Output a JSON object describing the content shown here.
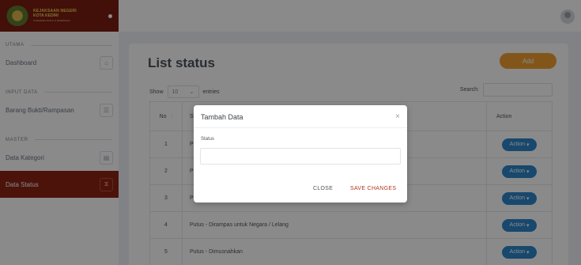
{
  "brand": {
    "line1": "KEJAKSAAN NEGERI",
    "line2": "KOTA KEDIRI",
    "line3": "SI-BARANG BUKTI & RAMPASAN"
  },
  "sidebar": {
    "section_utama": "UTAMA",
    "dashboard": "Dashboard",
    "section_input": "INPUT DATA",
    "barang": "Barang Bukti/Rampasan",
    "section_master": "MASTER",
    "kategori": "Data Kategori",
    "status": "Data Status",
    "icons": [
      "home-icon",
      "list-icon",
      "clipboard-icon",
      "hourglass-icon"
    ]
  },
  "page": {
    "title": "List status",
    "add_label": "Add",
    "show_label": "Show",
    "show_value": "10",
    "entries_label": "entries",
    "search_label": "Search:"
  },
  "table": {
    "col_no": "No",
    "col_status": "St",
    "col_action": "Action",
    "rows": [
      {
        "no": "1",
        "status": "P"
      },
      {
        "no": "2",
        "status": "P"
      },
      {
        "no": "3",
        "status": "P"
      },
      {
        "no": "4",
        "status": "Putus - Dirampas untuk Negara / Lelang"
      },
      {
        "no": "5",
        "status": "Putus - Dimusnahkan"
      }
    ],
    "action_label": "Action"
  },
  "modal": {
    "title": "Tambah Data",
    "close_glyph": "×",
    "field_label": "Status",
    "field_value": "",
    "close_label": "CLOSE",
    "save_label": "SAVE CHANGES"
  },
  "colors": {
    "brand": "#7a1e10",
    "accent_orange": "#f0a030",
    "action_blue": "#2e86c9",
    "save_text": "#b03820"
  }
}
